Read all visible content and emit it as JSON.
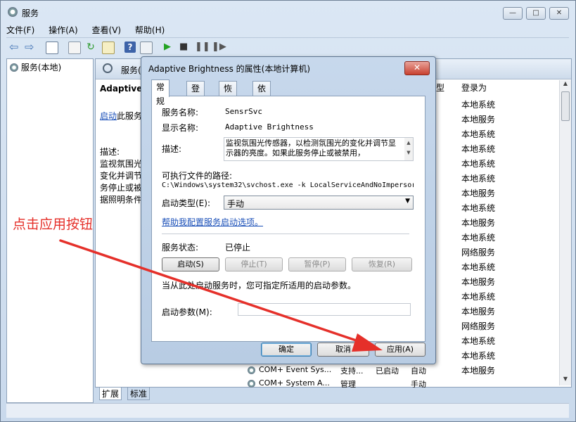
{
  "app": {
    "title": "服务"
  },
  "menu": [
    "文件(F)",
    "操作(A)",
    "查看(V)",
    "帮助(H)"
  ],
  "tree": {
    "root_label": "服务(本地)"
  },
  "main": {
    "header_title": "服务(本地)",
    "service_name_heading": "Adaptive",
    "start_link": "启动",
    "start_link_suffix": "此服务",
    "desc_label": "描述:",
    "desc_lines": [
      "监视氛围光",
      "变化并调节",
      "务停止或被",
      "据照明条件"
    ],
    "columns": {
      "startup_type_partial": "型",
      "logon_as": "登录为"
    },
    "logon_values": [
      "本地系统",
      "本地服务",
      "本地系统",
      "本地系统",
      "本地系统",
      "本地系统",
      "本地服务",
      "本地系统",
      "本地服务",
      "本地系统",
      "网络服务",
      "本地系统",
      "本地服务",
      "本地系统",
      "本地服务",
      "网络服务",
      "本地系统",
      "本地系统",
      "本地服务"
    ],
    "rows_bottom": [
      {
        "name": "COM+ Event Sys...",
        "status": "已启动",
        "startup": "自动",
        "pre": "支持..."
      },
      {
        "name": "COM+ System A...",
        "status": "管理",
        "startup": "手动",
        "pre": ""
      }
    ],
    "bottom_tabs": [
      "扩展",
      "标准"
    ]
  },
  "dialog": {
    "title": "Adaptive Brightness 的属性(本地计算机)",
    "tabs": [
      "常规",
      "登录",
      "恢复",
      "依存关系"
    ],
    "service_name_label": "服务名称:",
    "service_name": "SensrSvc",
    "display_name_label": "显示名称:",
    "display_name": "Adaptive Brightness",
    "description_label": "描述:",
    "description": "监视氛围光传感器，以检测氛围光的变化并调节显示器的亮度。如果此服务停止或被禁用，",
    "exe_path_label": "可执行文件的路径:",
    "exe_path": "C:\\Windows\\system32\\svchost.exe -k LocalServiceAndNoImpersor",
    "startup_type_label": "启动类型(E):",
    "startup_type": "手动",
    "help_link": "帮助我配置服务启动选项。",
    "status_label": "服务状态:",
    "status_value": "已停止",
    "buttons": {
      "start": "启动(S)",
      "stop": "停止(T)",
      "pause": "暂停(P)",
      "resume": "恢复(R)"
    },
    "params_hint": "当从此处启动服务时，您可指定所适用的启动参数。",
    "params_label": "启动参数(M):",
    "params_value": "",
    "footer": {
      "ok": "确定",
      "cancel": "取消",
      "apply": "应用(A)"
    }
  },
  "annotation": {
    "text": "点击应用按钮",
    "color": "#e5302a"
  }
}
